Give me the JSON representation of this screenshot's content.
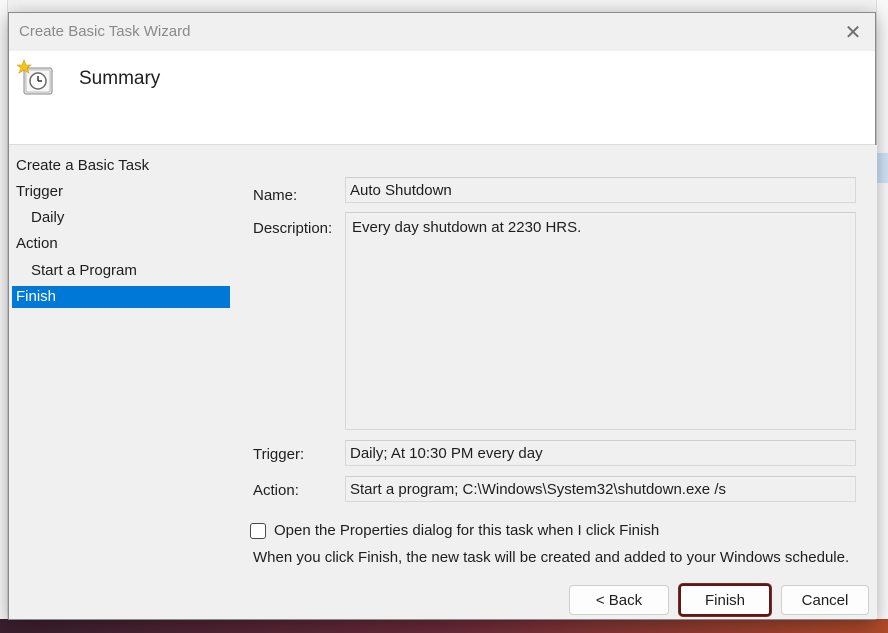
{
  "window": {
    "title": "Create Basic Task Wizard",
    "close_glyph": "✕"
  },
  "header": {
    "heading": "Summary",
    "icon": "task-scheduler-clock-icon"
  },
  "steps": [
    {
      "label": "Create a Basic Task",
      "sub": false,
      "active": false
    },
    {
      "label": "Trigger",
      "sub": false,
      "active": false
    },
    {
      "label": "Daily",
      "sub": true,
      "active": false
    },
    {
      "label": "Action",
      "sub": false,
      "active": false
    },
    {
      "label": "Start a Program",
      "sub": true,
      "active": false
    },
    {
      "label": "Finish",
      "sub": false,
      "active": true
    }
  ],
  "summary": {
    "name_label": "Name:",
    "name_value": "Auto Shutdown",
    "description_label": "Description:",
    "description_value": "Every day shutdown at 2230 HRS.",
    "trigger_label": "Trigger:",
    "trigger_value": "Daily; At 10:30 PM every day",
    "action_label": "Action:",
    "action_value": "Start a program; C:\\Windows\\System32\\shutdown.exe /s"
  },
  "options": {
    "open_properties_label": "Open the Properties dialog for this task when I click Finish",
    "open_properties_checked": false,
    "info_text": "When you click Finish, the new task will be created and added to your Windows schedule."
  },
  "buttons": {
    "back": "< Back",
    "finish": "Finish",
    "cancel": "Cancel"
  },
  "colors": {
    "selection": "#0078d7",
    "focus_border": "#5a1a1a"
  }
}
